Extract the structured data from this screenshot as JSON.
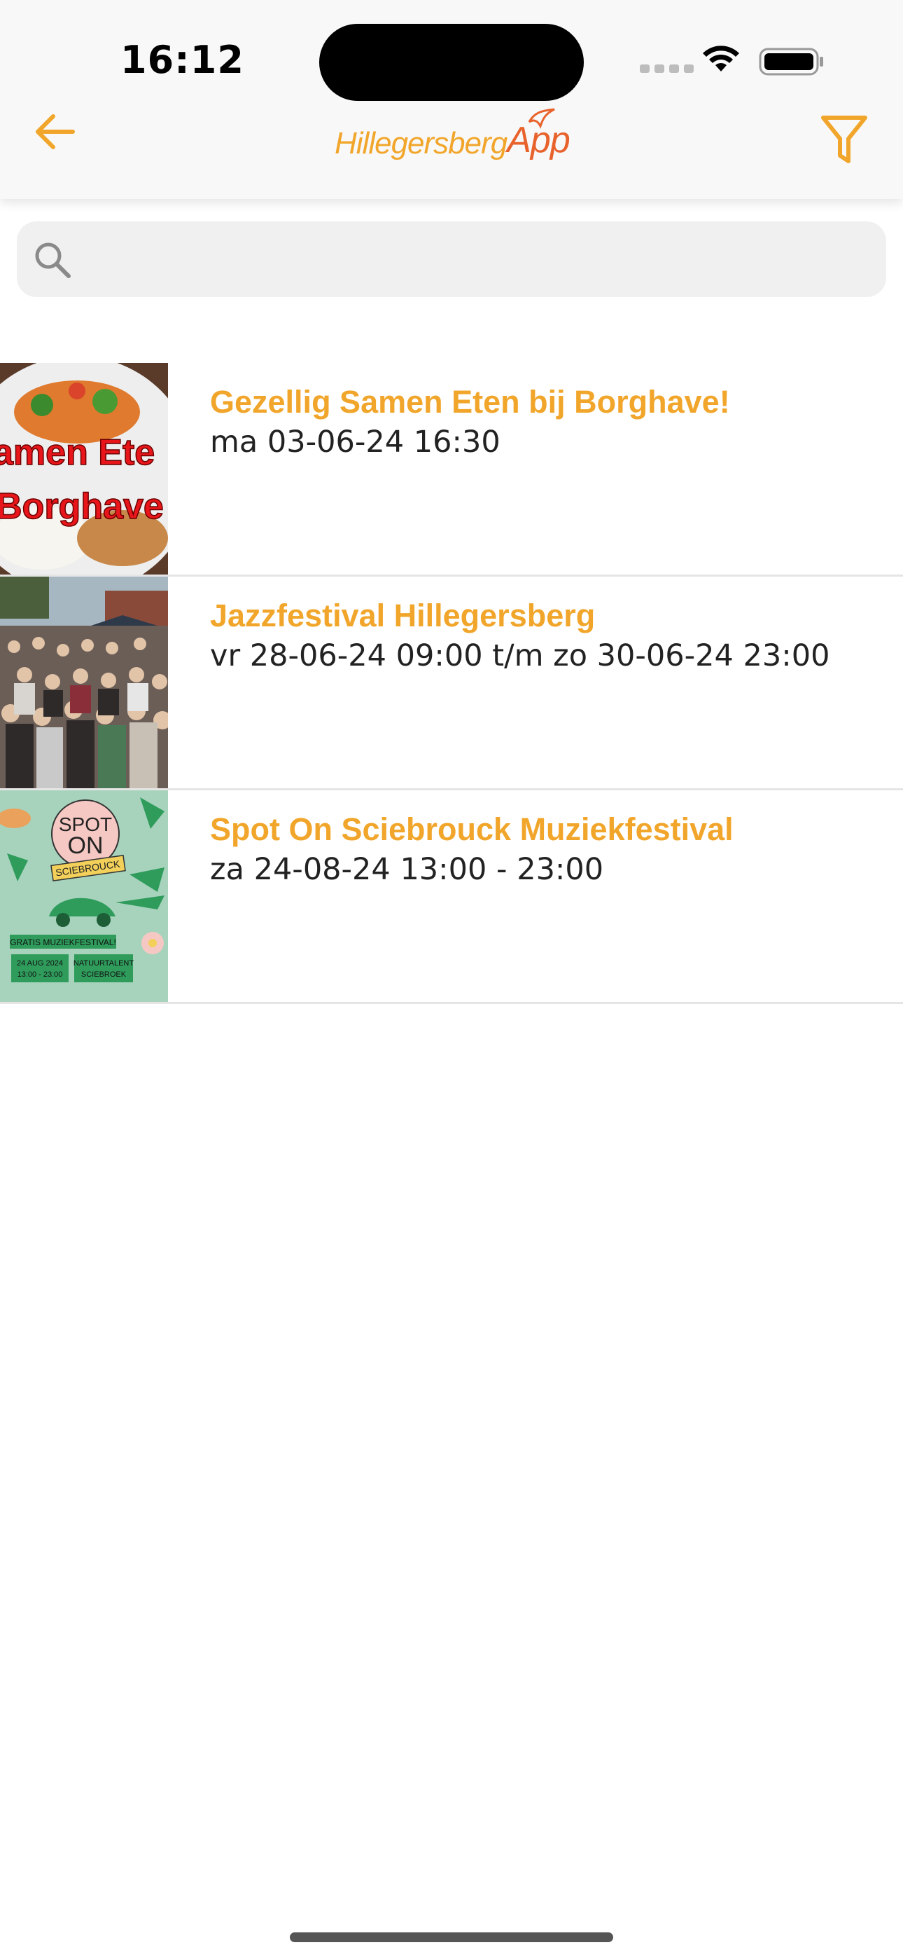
{
  "status": {
    "time": "16:12"
  },
  "header": {
    "logo_part1": "Hillegersberg",
    "logo_part2": "App"
  },
  "search": {
    "placeholder": "",
    "value": ""
  },
  "events": [
    {
      "title": "Gezellig Samen Eten bij Borghave!",
      "date": "ma 03-06-24 16:30",
      "thumb_text_1": "amen Ete",
      "thumb_text_2": "Borghave"
    },
    {
      "title": "Jazzfestival Hillegersberg",
      "date": "vr 28-06-24 09:00 t/m zo 30-06-24 23:00"
    },
    {
      "title": "Spot On Sciebrouck Muziekfestival",
      "date": "za 24-08-24 13:00 - 23:00",
      "thumb_spot": "SPOT",
      "thumb_on": "ON",
      "thumb_banner": "SCIEBROUCK",
      "thumb_line1": "GRATIS MUZIEKFESTIVAL!",
      "thumb_line2a": "24 AUG 2024",
      "thumb_line2b": "13:00 - 23:00",
      "thumb_line3a": "NATUURTALENT",
      "thumb_line3b": "SCIEBROEK"
    }
  ],
  "colors": {
    "accent": "#f1a62b",
    "logo_app": "#e8622c"
  }
}
